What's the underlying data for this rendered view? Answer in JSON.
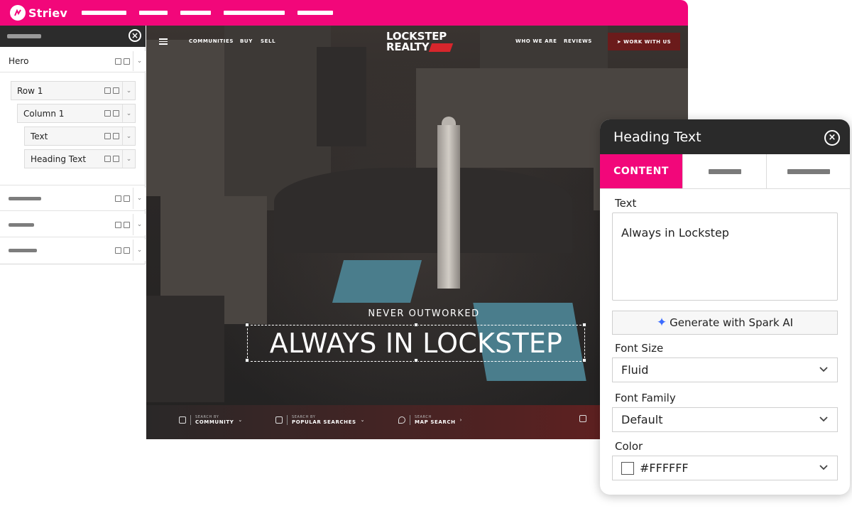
{
  "app": {
    "brand": "Striev"
  },
  "sidebar": {
    "items": [
      {
        "label": "Hero"
      },
      {
        "label": "Row 1"
      },
      {
        "label": "Column 1"
      },
      {
        "label": "Text"
      },
      {
        "label": "Heading Text"
      }
    ]
  },
  "site": {
    "nav_left": [
      "COMMUNITIES",
      "BUY",
      "SELL"
    ],
    "brand_line1": "LOCKSTEP",
    "brand_line2": "REALTY",
    "nav_right": [
      "WHO WE ARE",
      "REVIEWS"
    ],
    "cta": "WORK WITH US",
    "hero_sub": "NEVER OUTWORKED",
    "hero_heading": "ALWAYS IN LOCKSTEP",
    "search": [
      {
        "small": "SEARCH BY",
        "big": "COMMUNITY"
      },
      {
        "small": "SEARCH BY",
        "big": "POPULAR SEARCHES"
      },
      {
        "small": "SEARCH",
        "big": "MAP SEARCH"
      }
    ]
  },
  "panel": {
    "title": "Heading Text",
    "tabs": {
      "active": "CONTENT"
    },
    "text_label": "Text",
    "text_value": "Always in Lockstep",
    "spark_label": "Generate with Spark AI",
    "font_size_label": "Font Size",
    "font_size_value": "Fluid",
    "font_family_label": "Font Family",
    "font_family_value": "Default",
    "color_label": "Color",
    "color_value": "#FFFFFF"
  },
  "colors": {
    "accent": "#f2077a",
    "dark": "#2a2a2a",
    "cta": "#6b1b1b"
  }
}
